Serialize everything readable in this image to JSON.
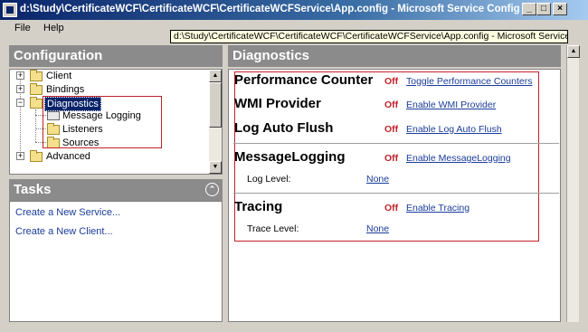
{
  "window": {
    "title": "d:\\Study\\CertificateWCF\\CertificateWCF\\CertificateWCFService\\App.config - Microsoft Service Configur...",
    "tooltip": "d:\\Study\\CertificateWCF\\CertificateWCF\\CertificateWCFService\\App.config - Microsoft Service Co",
    "controls": {
      "minimize": "_",
      "maximize": "□",
      "close": "×"
    }
  },
  "menu": {
    "file": "File",
    "help": "Help"
  },
  "configuration": {
    "title": "Configuration",
    "tree": [
      {
        "label": "Client",
        "expander": "+"
      },
      {
        "label": "Bindings",
        "expander": "+"
      },
      {
        "label": "Diagnostics",
        "expander": "−",
        "selected": true
      },
      {
        "label": "Message Logging"
      },
      {
        "label": "Listeners"
      },
      {
        "label": "Sources"
      },
      {
        "label": "Advanced",
        "expander": "+"
      }
    ]
  },
  "tasks": {
    "title": "Tasks",
    "collapse": "⌃",
    "links": [
      "Create a New Service...",
      "Create a New Client..."
    ]
  },
  "diagnostics": {
    "title": "Diagnostics",
    "features": [
      {
        "name": "Performance Counter",
        "status": "Off",
        "action": "Toggle Performance Counters"
      },
      {
        "name": "WMI Provider",
        "status": "Off",
        "action": "Enable WMI Provider"
      },
      {
        "name": "Log Auto Flush",
        "status": "Off",
        "action": "Enable Log Auto Flush"
      },
      {
        "name": "MessageLogging",
        "status": "Off",
        "action": "Enable MessageLogging",
        "level_label": "Log Level:",
        "level_value": "None"
      },
      {
        "name": "Tracing",
        "status": "Off",
        "action": "Enable Tracing",
        "level_label": "Trace Level:",
        "level_value": "None"
      }
    ]
  },
  "colors": {
    "title_bar": "#0a246a",
    "pane_header": "#8b8b8b",
    "link": "#1a3c9a",
    "off_status": "#c0222a",
    "highlight_frame": "#c0222a"
  }
}
